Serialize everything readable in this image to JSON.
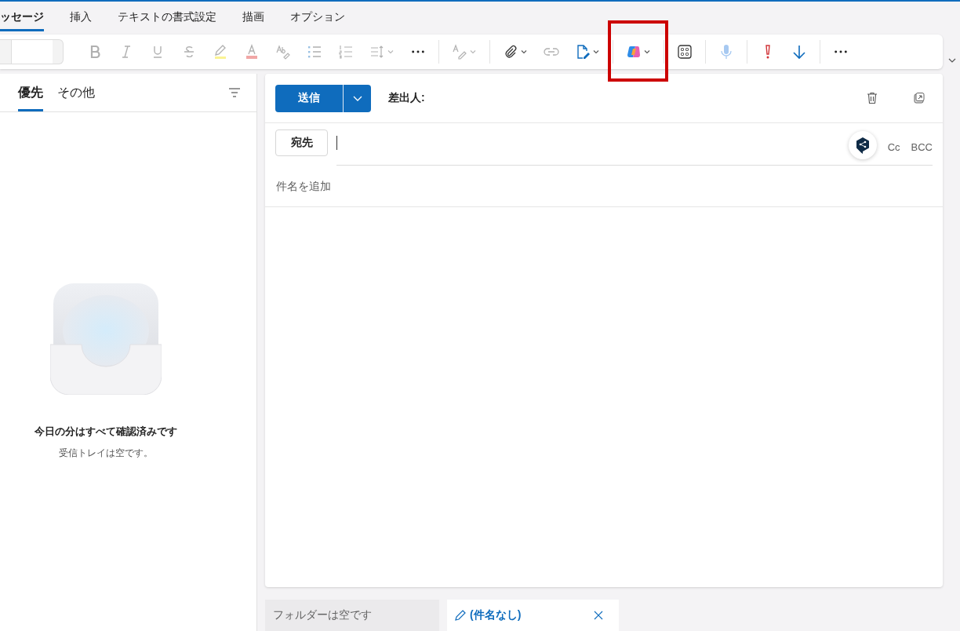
{
  "ribbon_tabs": [
    {
      "label": "ッセージ",
      "selected": true
    },
    {
      "label": "挿入",
      "selected": false
    },
    {
      "label": "テキストの書式設定",
      "selected": false
    },
    {
      "label": "描画",
      "selected": false
    },
    {
      "label": "オプション",
      "selected": false
    }
  ],
  "toolbar": {
    "groups": [
      [
        {
          "kind": "bold",
          "disabled": true,
          "dropdown": false,
          "highlighted": false
        },
        {
          "kind": "italic",
          "disabled": true,
          "dropdown": false,
          "highlighted": false
        },
        {
          "kind": "underline",
          "disabled": true,
          "dropdown": false,
          "highlighted": false
        },
        {
          "kind": "strikethrough",
          "disabled": true,
          "dropdown": false,
          "highlighted": false
        },
        {
          "kind": "highlight",
          "disabled": true,
          "dropdown": false,
          "highlighted": false
        },
        {
          "kind": "font-color",
          "disabled": true,
          "dropdown": false,
          "highlighted": false
        },
        {
          "kind": "clear-format",
          "disabled": true,
          "dropdown": false,
          "highlighted": false
        },
        {
          "kind": "bullets",
          "disabled": true,
          "dropdown": false,
          "highlighted": false
        },
        {
          "kind": "numbering",
          "disabled": true,
          "dropdown": false,
          "highlighted": false
        },
        {
          "kind": "spacing",
          "disabled": true,
          "dropdown": true,
          "highlighted": false
        },
        {
          "kind": "more",
          "disabled": false,
          "dropdown": false,
          "highlighted": false
        }
      ],
      [
        {
          "kind": "styles",
          "disabled": true,
          "dropdown": true,
          "highlighted": false
        }
      ],
      [
        {
          "kind": "attach",
          "disabled": false,
          "dropdown": true,
          "highlighted": false
        },
        {
          "kind": "link",
          "disabled": true,
          "dropdown": false,
          "highlighted": false
        },
        {
          "kind": "editor",
          "disabled": false,
          "dropdown": true,
          "highlighted": false
        }
      ],
      [
        {
          "kind": "copilot",
          "disabled": false,
          "dropdown": true,
          "highlighted": true
        }
      ],
      [
        {
          "kind": "apps",
          "disabled": false,
          "dropdown": false,
          "highlighted": false
        }
      ],
      [
        {
          "kind": "mic",
          "disabled": true,
          "dropdown": false,
          "highlighted": false
        }
      ],
      [
        {
          "kind": "importance",
          "disabled": false,
          "dropdown": false,
          "highlighted": false
        },
        {
          "kind": "low-importance",
          "disabled": false,
          "dropdown": false,
          "highlighted": false
        }
      ],
      [
        {
          "kind": "more",
          "disabled": false,
          "dropdown": false,
          "highlighted": false
        }
      ]
    ]
  },
  "message_list": {
    "tabs": [
      {
        "label": "優先",
        "selected": true
      },
      {
        "label": "その他",
        "selected": false
      }
    ],
    "empty_state": {
      "title": "今日の分はすべて確認済みです",
      "message": "受信トレイは空です。"
    }
  },
  "compose": {
    "send": "送信",
    "from_label": "差出人:",
    "to_button": "宛先",
    "cc": "Cc",
    "bcc": "BCC",
    "subject": {
      "placeholder": "件名を追加"
    }
  },
  "bottom_tabs": [
    {
      "kind": "folder",
      "label": "フォルダーは空です",
      "selected": false
    },
    {
      "kind": "draft",
      "label": "(件名なし)",
      "selected": true
    }
  ]
}
